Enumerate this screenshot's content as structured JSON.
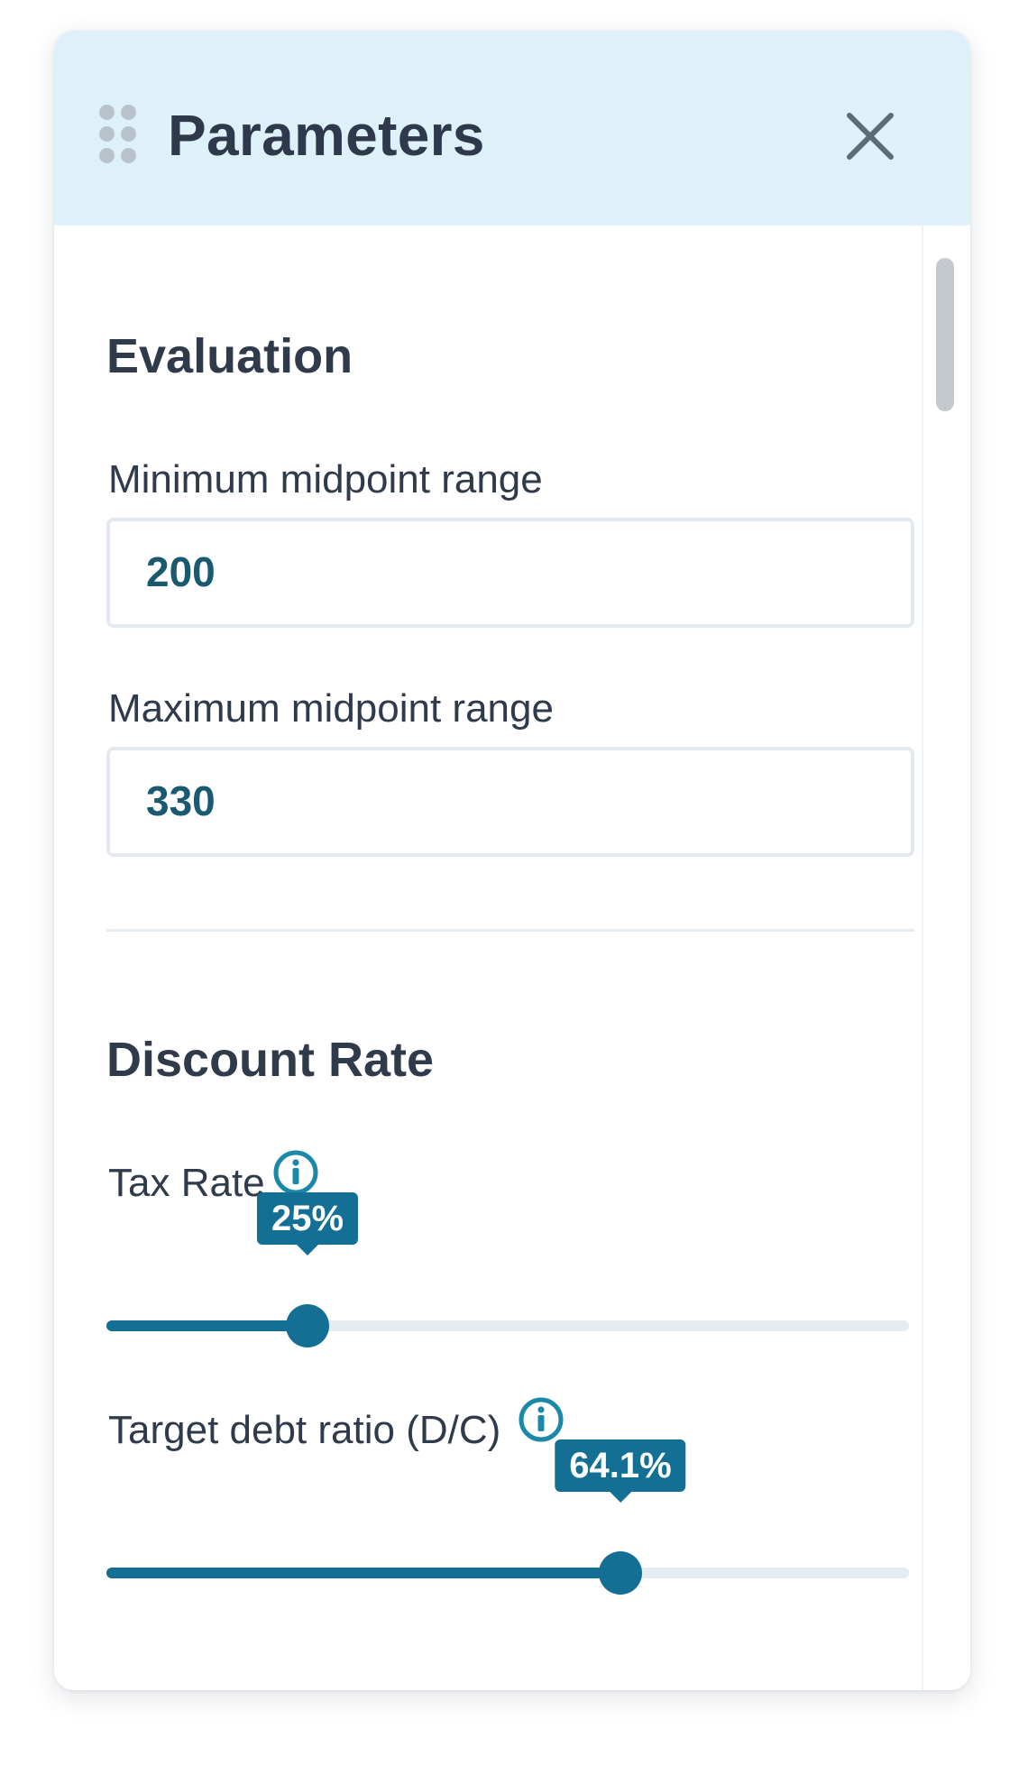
{
  "panel": {
    "title": "Parameters",
    "drag_icon": "drag-handle-icon",
    "close_icon": "close-icon"
  },
  "evaluation": {
    "title": "Evaluation",
    "min_label": "Minimum midpoint range",
    "min_value": "200",
    "max_label": "Maximum midpoint range",
    "max_value": "330"
  },
  "discount_rate": {
    "title": "Discount Rate",
    "tax_rate": {
      "label": "Tax Rate",
      "value_text": "25%",
      "value_fraction": 0.25,
      "info_icon": "info-icon"
    },
    "debt_ratio": {
      "label": "Target debt ratio (D/C)",
      "value_text": "64.1%",
      "value_fraction": 0.641,
      "info_icon": "info-icon"
    }
  },
  "colors": {
    "header_bg": "#dff1f8",
    "accent": "#136f93",
    "input_value": "#195a70",
    "text": "#2f3a4b"
  }
}
